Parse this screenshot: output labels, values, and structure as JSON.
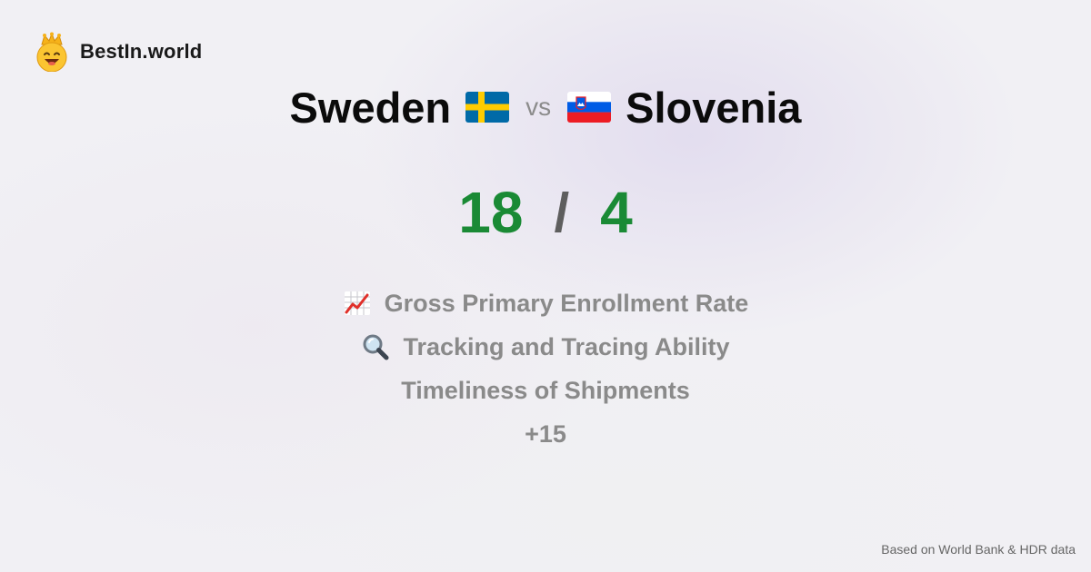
{
  "brand": {
    "name": "BestIn.world",
    "logo_icon": "crowned-smiley-icon"
  },
  "comparison": {
    "left_country": "Sweden",
    "left_flag_icon": "sweden-flag-icon",
    "vs_label": "vs",
    "right_country": "Slovenia",
    "right_flag_icon": "slovenia-flag-icon"
  },
  "score": {
    "left": "18",
    "separator": "/",
    "right": "4"
  },
  "metrics": [
    {
      "icon": "chart-increasing-icon",
      "label": "Gross Primary Enrollment Rate"
    },
    {
      "icon": "magnifying-glass-icon",
      "label": "Tracking and Tracing Ability"
    },
    {
      "icon": "",
      "label": "Timeliness of Shipments"
    }
  ],
  "more_label": "+15",
  "source_note": "Based on World Bank & HDR data",
  "colors": {
    "score_green": "#1a8a35",
    "metric_gray": "#8a8a8a",
    "sweden_blue": "#006aa7",
    "sweden_yellow": "#fecc00",
    "slovenia_red": "#ed1c24",
    "slovenia_blue": "#005ce5"
  }
}
